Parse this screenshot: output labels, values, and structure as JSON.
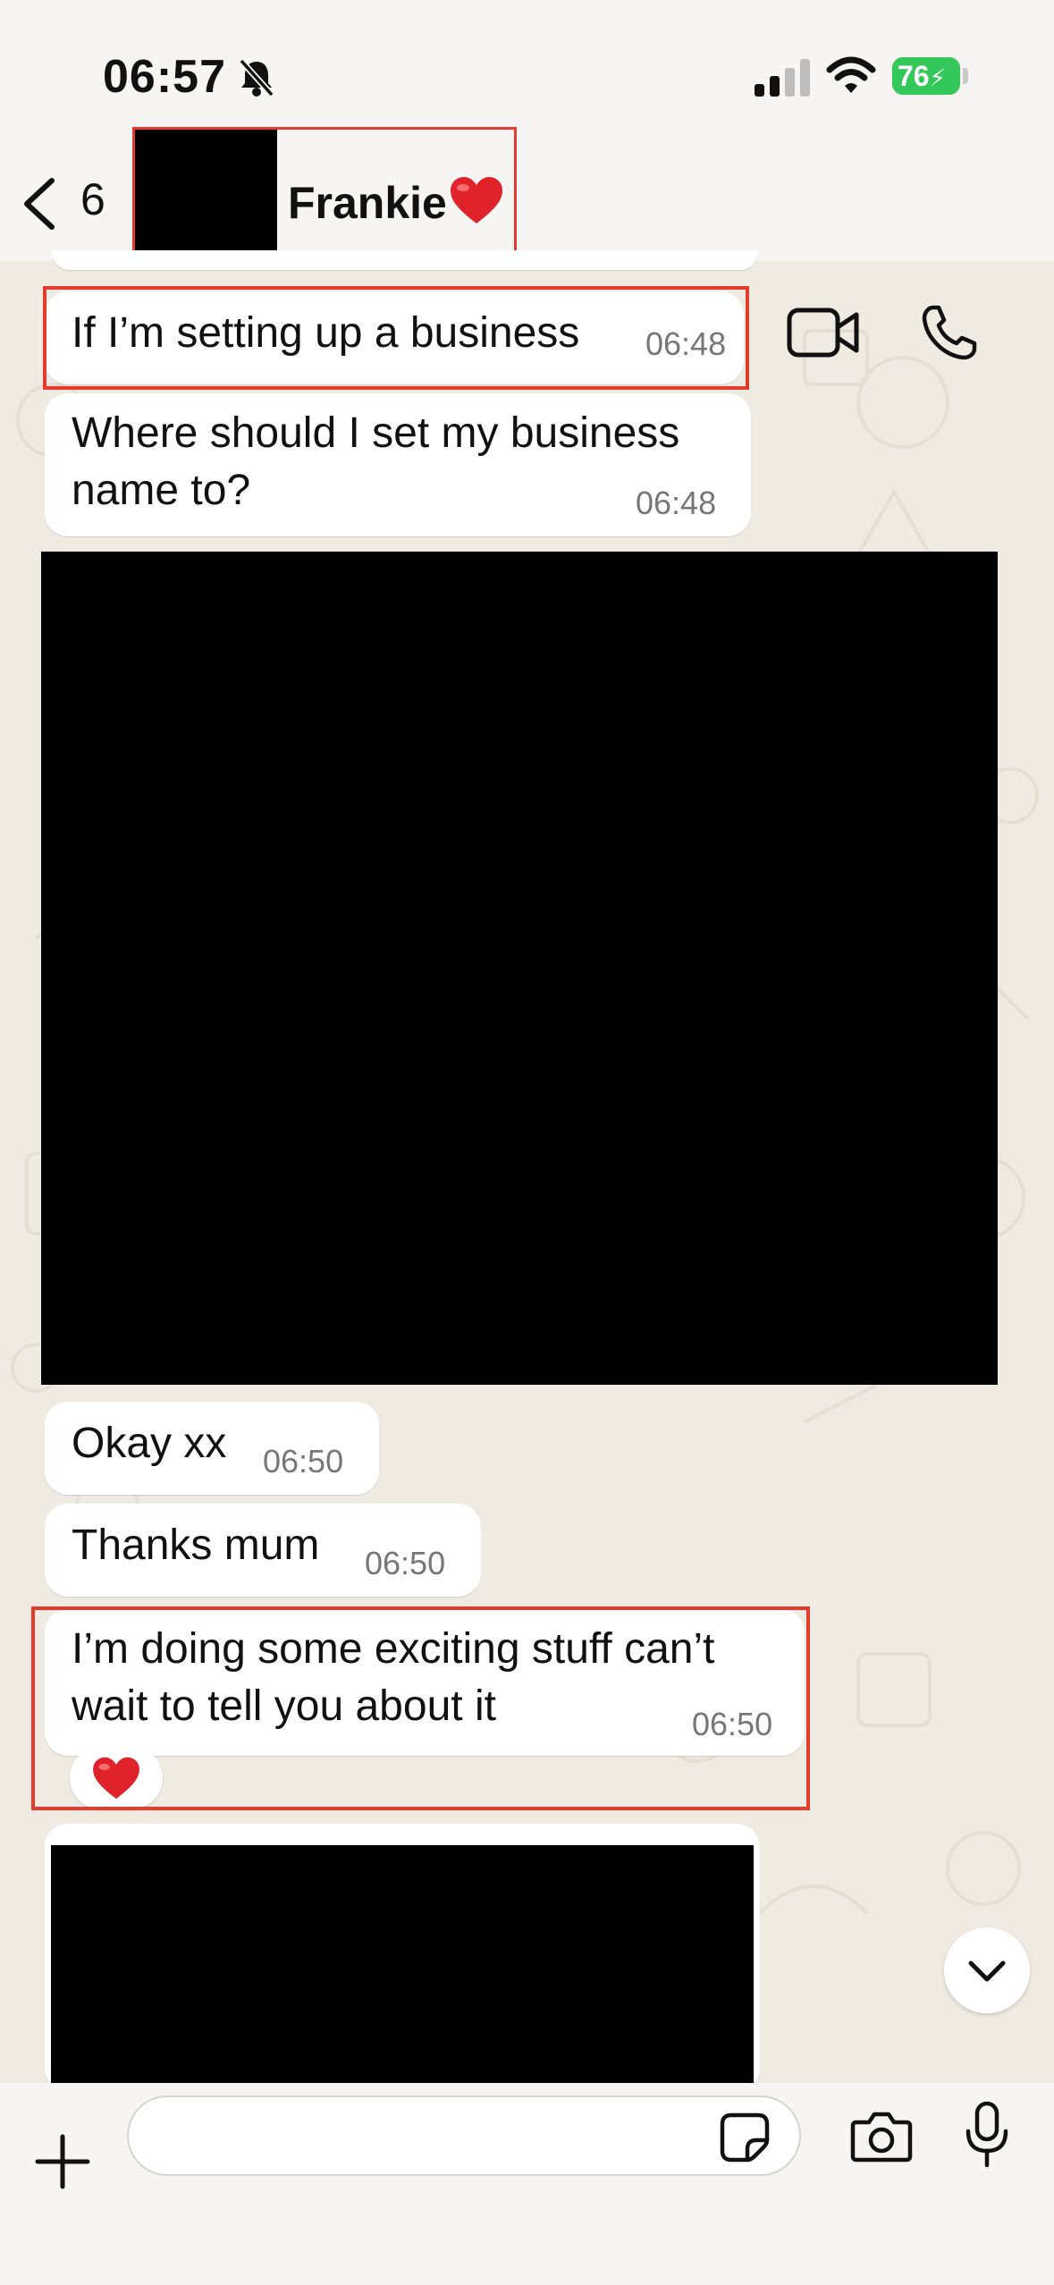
{
  "status": {
    "time": "06:57",
    "battery": "76"
  },
  "header": {
    "back_count": "6",
    "contact_name": "Frankie"
  },
  "messages": [
    {
      "text_lines": [
        "If I’m setting up a business"
      ],
      "time": "06:48"
    },
    {
      "text_lines": [
        "Where should I set my business",
        "name to?"
      ],
      "time": "06:48"
    },
    {
      "text_lines": [
        "Okay xx"
      ],
      "time": "06:50"
    },
    {
      "text_lines": [
        "Thanks mum"
      ],
      "time": "06:50"
    },
    {
      "text_lines": [
        "I’m doing some exciting stuff can’t",
        "wait to tell you about it"
      ],
      "time": "06:50"
    }
  ],
  "input": {
    "placeholder": ""
  },
  "colors": {
    "background": "#efeae2",
    "bubble": "#ffffff",
    "highlight": "#e53b2c",
    "battery": "#34c759",
    "heart": "#e0222b"
  }
}
